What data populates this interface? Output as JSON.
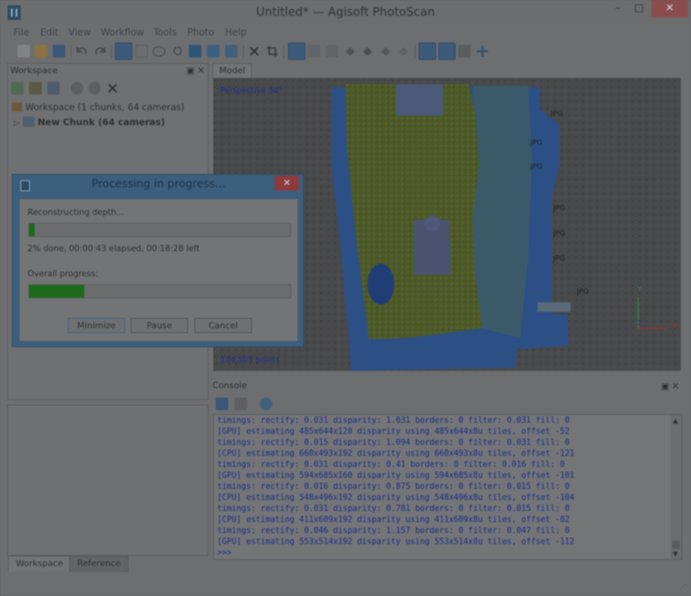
{
  "window": {
    "title": "Untitled* — Agisoft PhotoScan",
    "minimize": "–",
    "maximize": "□",
    "close": "✕"
  },
  "menu": [
    "File",
    "Edit",
    "View",
    "Workflow",
    "Tools",
    "Photo",
    "Help"
  ],
  "workspace": {
    "title": "Workspace",
    "root": "Workspace (1 chunks, 64 cameras)",
    "chunk": "New Chunk (64 cameras)",
    "tabs": [
      "Workspace",
      "Reference"
    ]
  },
  "model": {
    "tab": "Model",
    "view_label": "Perspective 30°",
    "points_label": "104,503 points",
    "axes": {
      "x": "X",
      "y": "Y",
      "z": "Z"
    },
    "camera_labels": [
      ".JPG",
      ".JPG",
      "JPG",
      "JPG",
      "JPG",
      "JPG",
      "JPG"
    ]
  },
  "console": {
    "title": "Console",
    "lines": [
      "timings: rectify: 0.031 disparity: 1.031 borders: 0 filter: 0.031 fill: 0",
      "[GPU] estimating 485x644x128 disparity using 485x644x8u tiles, offset -52",
      "timings: rectify: 0.015 disparity: 1.094 borders: 0 filter: 0.031 fill: 0",
      "[CPU] estimating 660x493x192 disparity using 660x493x8u tiles, offset -121",
      "timings: rectify: 0.031 disparity: 0.41 borders: 0 filter: 0.016 fill: 0",
      "[GPU] estimating 594x685x160 disparity using 594x685x8u tiles, offset -101",
      "timings: rectify: 0.016 disparity: 0.875 borders: 0 filter: 0.015 fill: 0",
      "[CPU] estimating 548x496x192 disparity using 548x496x8u tiles, offset -104",
      "timings: rectify: 0.031 disparity: 0.781 borders: 0 filter: 0.015 fill: 0",
      "[CPU] estimating 411x609x192 disparity using 411x609x8u tiles, offset -82",
      "timings: rectify: 0.046 disparity: 1.157 borders: 0 filter: 0.047 fill: 0",
      "[GPU] estimating 553x514x192 disparity using 553x514x8u tiles, offset -112",
      ">>>"
    ]
  },
  "dialog": {
    "title": "Processing in progress...",
    "close": "✕",
    "stage": "Reconstructing depth...",
    "stage_progress": 0.02,
    "status": "2% done, 00:00:43 elapsed, 00:18:28 left",
    "overall_label": "Overall progress:",
    "overall_progress": 0.21,
    "buttons": {
      "minimize": "Minimize",
      "pause": "Pause",
      "cancel": "Cancel"
    }
  },
  "colors": {
    "dim_overlay": "#6c6e70",
    "progress_fill": "#1a6a1a",
    "dialog_frame": "#3b5f7d",
    "console_text": "#1c2a86"
  }
}
